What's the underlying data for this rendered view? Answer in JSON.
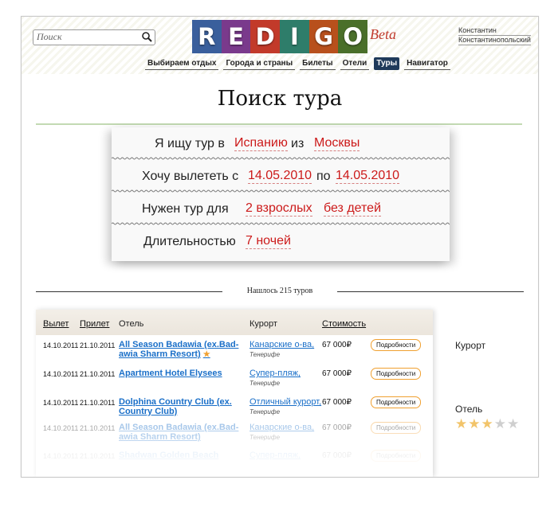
{
  "header": {
    "search_placeholder": "Поиск",
    "logo_letters": [
      "R",
      "E",
      "D",
      "I",
      "G",
      "O"
    ],
    "logo_colors": [
      "#3a5f9c",
      "#7a3a8c",
      "#c23a2a",
      "#2e7d6a",
      "#b8501c",
      "#4a6f2a"
    ],
    "beta": "Beta",
    "user_first": "Константин",
    "user_last": "Константинопольский"
  },
  "nav": {
    "items": [
      "Выбираем отдых",
      "Города и страны",
      "Билеты",
      "Отели",
      "Туры",
      "Навигатор"
    ],
    "active": "Туры"
  },
  "page_title": "Поиск тура",
  "form": {
    "row1": {
      "label": "Я ищу тур в",
      "country": "Испанию",
      "mid": "из",
      "city": "Москвы"
    },
    "row2": {
      "label": "Хочу вылететь с",
      "date_from": "14.05.2010",
      "mid": "по",
      "date_to": "14.05.2010"
    },
    "row3": {
      "label": "Нужен тур для",
      "adults": "2 взрослых",
      "children": "без детей"
    },
    "row4": {
      "label": "Длительностью",
      "nights": "7 ночей"
    }
  },
  "found_text": "Нашлось 215 туров",
  "table": {
    "headers": {
      "departure": "Вылет",
      "arrival": "Прилет",
      "hotel": "Отель",
      "resort": "Курорт",
      "price": "Стоимость"
    },
    "rows": [
      {
        "departure": "14.10.2011",
        "arrival": "21.10.2011",
        "hotel_l1": "All Season Badawia (ex.Bad-",
        "hotel_l2": "awia Sharm Resort)",
        "star": "★",
        "resort": "Канарские о-ва,",
        "region": "Тенерифе",
        "price": "67 000₽",
        "details": "Подробности"
      },
      {
        "departure": "14.10.2011",
        "arrival": "21.10.2011",
        "hotel_l1": "Apartment Hotel Elysees",
        "hotel_l2": "",
        "star": "",
        "resort": "Супер-пляж,",
        "region": "Тенерифе",
        "price": "67 000₽",
        "details": "Подробности"
      },
      {
        "departure": "14.10.2011",
        "arrival": "21.10.2011",
        "hotel_l1": "Dolphina Country Club (ex.",
        "hotel_l2": "Country Club)",
        "star": "",
        "resort": "Отличный курорт,",
        "region": "Тенерифе",
        "price": "67 000₽",
        "details": "Подробности"
      },
      {
        "departure": "14.10.2011",
        "arrival": "21.10.2011",
        "hotel_l1": "All Season Badawia (ex.Bad-",
        "hotel_l2": "awia Sharm Resort)",
        "star": "",
        "resort": "Канарские о-ва,",
        "region": "Тенерифе",
        "price": "67 000₽",
        "details": "Подробности"
      },
      {
        "departure": "14.10.2011",
        "arrival": "21.10.2011",
        "hotel_l1": "Shadwan Golden Beach",
        "hotel_l2": "",
        "star": "",
        "resort": "Супер-пляж,",
        "region": "",
        "price": "67 000₽",
        "details": "Подробности"
      }
    ]
  },
  "sidebar": {
    "resort_label": "Курорт",
    "hotel_label": "Отель",
    "stars": [
      "★",
      "★",
      "★",
      "★",
      "★"
    ],
    "stars_selected": 3,
    "star_color_on": "#f2c46a",
    "star_color_off": "#cfcfcf"
  }
}
